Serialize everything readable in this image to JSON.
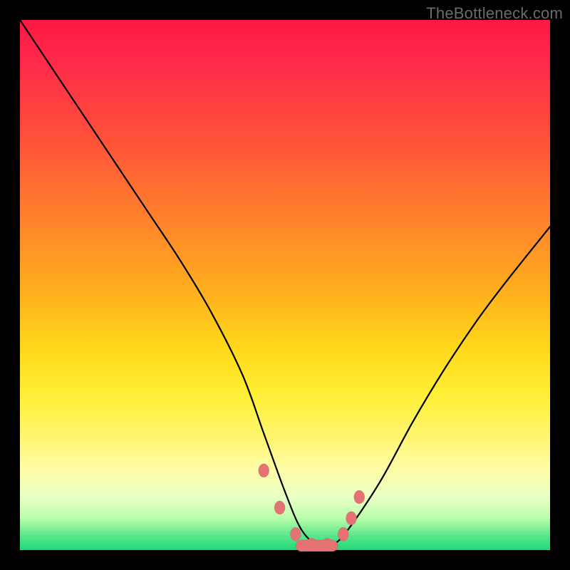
{
  "watermark": "TheBottleneck.com",
  "colors": {
    "frame": "#000000",
    "gradient_top": "#ff1744",
    "gradient_mid": "#ffd81a",
    "gradient_bottom": "#1fd876",
    "curve": "#000000",
    "marker": "#e57373"
  },
  "chart_data": {
    "type": "line",
    "title": "",
    "xlabel": "",
    "ylabel": "",
    "xlim": [
      0,
      100
    ],
    "ylim": [
      0,
      100
    ],
    "note": "V-shaped bottleneck curve over a red-to-green vertical gradient. Axis values are estimated from plot position; original image has no numeric tick labels.",
    "series": [
      {
        "name": "bottleneck-curve",
        "x": [
          0,
          6,
          12,
          18,
          24,
          30,
          36,
          42,
          46,
          50,
          53,
          56,
          59,
          62,
          68,
          74,
          80,
          86,
          92,
          100
        ],
        "y": [
          100,
          91,
          82,
          73,
          64,
          55,
          45,
          33,
          22,
          11,
          4,
          1,
          1,
          4,
          13,
          24,
          34,
          43,
          51,
          61
        ]
      }
    ],
    "markers": {
      "name": "highlighted-points",
      "x": [
        46,
        49,
        52,
        55,
        58,
        61,
        62.5,
        64
      ],
      "y": [
        15,
        8,
        3,
        1,
        1,
        3,
        6,
        10
      ]
    }
  }
}
